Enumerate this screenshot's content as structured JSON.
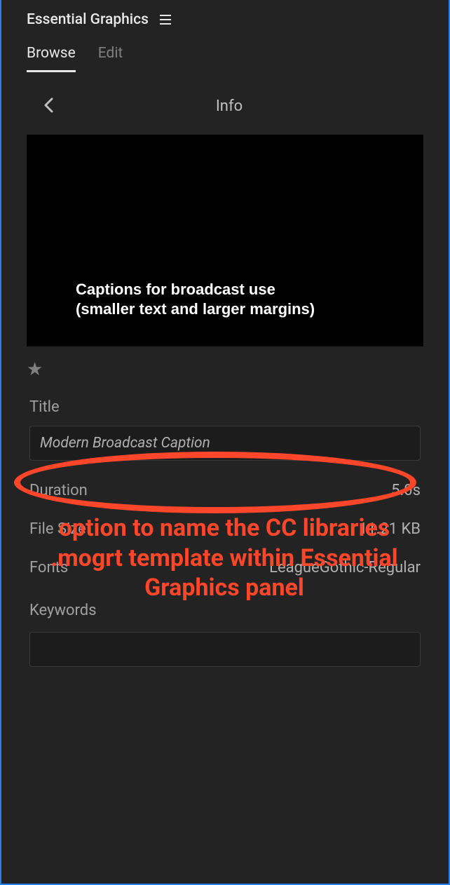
{
  "panel": {
    "title": "Essential Graphics"
  },
  "tabs": {
    "browse": "Browse",
    "edit": "Edit"
  },
  "info": {
    "header_label": "Info"
  },
  "preview": {
    "line1": "Captions for broadcast use",
    "line2": "(smaller text and larger margins)"
  },
  "title": {
    "label": "Title",
    "value": "Modern Broadcast Caption"
  },
  "meta": {
    "duration_label": "Duration",
    "duration_value": "5.0s",
    "filesize_label": "File Size",
    "filesize_value": "11.21 KB",
    "fonts_label": "Fonts",
    "fonts_value": "LeagueGothic-Regular"
  },
  "keywords": {
    "label": "Keywords",
    "value": ""
  },
  "annotation": {
    "text": "option to name the CC libraries .mogrt template within Essential Graphics panel"
  }
}
